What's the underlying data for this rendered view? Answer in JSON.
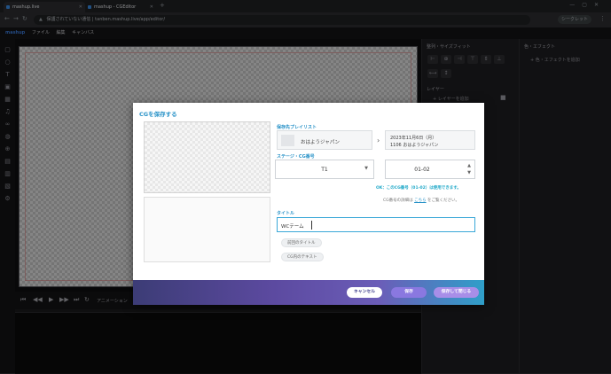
{
  "browser": {
    "tabs": [
      {
        "label": "mashup.live"
      },
      {
        "label": "mashup - CGEditor"
      }
    ],
    "url": "保護されていない通信 | tanben.mashup.live/app/editor/",
    "profile": "シークレット"
  },
  "app": {
    "logo": "mashup",
    "menu": [
      "ファイル",
      "編集",
      "キャンバス"
    ]
  },
  "panels": {
    "align_title": "整列・サイズフィット",
    "layer_title": "レイヤー",
    "add_layer": "+ レイヤーを追加",
    "color_title": "色・エフェクト",
    "add_color": "+ 色・エフェクトを追加"
  },
  "transport": {
    "animation_label": "アニメーション"
  },
  "dialog": {
    "title": "CGを保存する",
    "playlist_label": "保存先プレイリスト",
    "playlist_name": "おはようジャパン",
    "playlist_date": "2023年11月6日（月）",
    "playlist_detail": "1106 おはようジャパン",
    "stage_label": "ステージ・CG番号",
    "stage_value": "T1",
    "cg_number": "01-02",
    "ok_message": "OK：このCG番号（01-02）は使用できます。",
    "hint_prefix": "CG番号の詳細は",
    "hint_link": "こちら",
    "hint_suffix": "をご覧ください。",
    "title_label": "タイトル",
    "title_value": "WCテーム",
    "chip_previous": "前回のタイトル",
    "chip_text": "CG内のテキスト",
    "cancel_label": "キャンセル",
    "save_label": "保存",
    "save_close_label": "保存して閉じる"
  }
}
